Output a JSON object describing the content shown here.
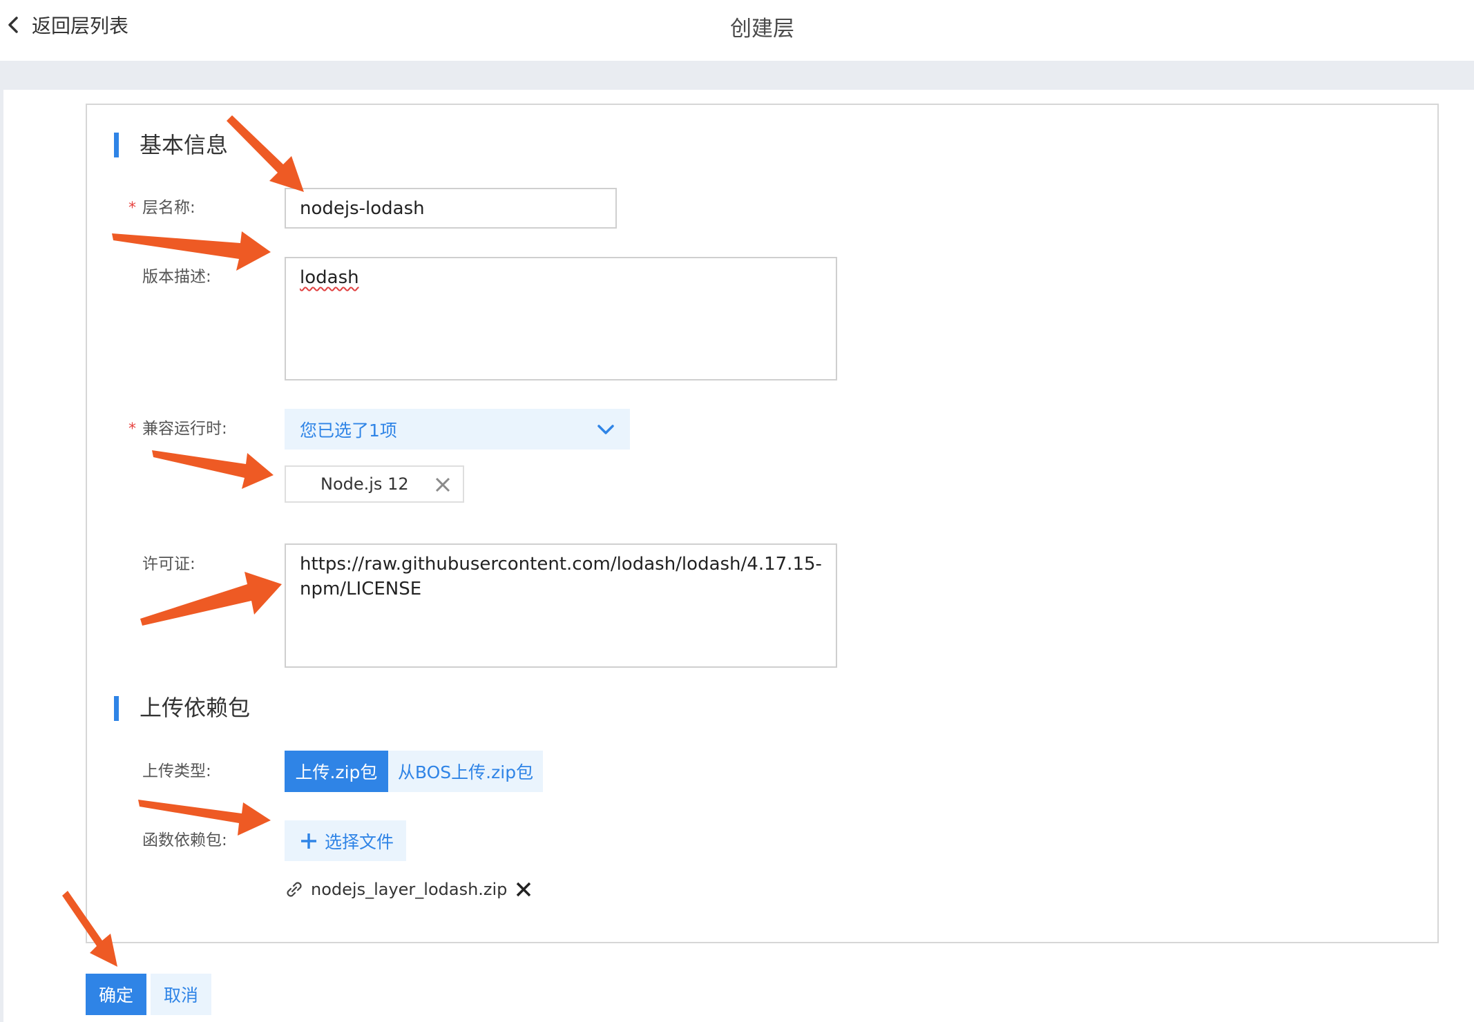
{
  "header": {
    "back_label": "返回层列表",
    "title": "创建层"
  },
  "basic_info": {
    "section_title": "基本信息",
    "name_label": "层名称:",
    "name_value": "nodejs-lodash",
    "desc_label": "版本描述:",
    "desc_value": "lodash",
    "runtime_label": "兼容运行时:",
    "runtime_select_text": "您已选了1项",
    "runtime_chip": "Node.js 12",
    "license_label": "许可证:",
    "license_value": "https://raw.githubusercontent.com/lodash/lodash/4.17.15-npm/LICENSE",
    "required_mark": "*"
  },
  "upload": {
    "section_title": "上传依赖包",
    "type_label": "上传类型:",
    "type_options": [
      "上传.zip包",
      "从BOS上传.zip包"
    ],
    "type_selected": "上传.zip包",
    "package_label": "函数依赖包:",
    "choose_file_label": "选择文件",
    "file_name": "nodejs_layer_lodash.zip"
  },
  "actions": {
    "confirm_label": "确定",
    "cancel_label": "取消"
  },
  "colors": {
    "accent": "#2f84e6",
    "accent_light": "#eaf4fd",
    "annotation_arrow": "#ee5a24",
    "required": "#e64340"
  },
  "icons": {
    "back": "chevron-left-icon",
    "dropdown": "chevron-down-icon",
    "chip_remove": "close-icon",
    "choose_file": "plus-icon",
    "file": "link-icon",
    "file_remove": "close-icon"
  }
}
